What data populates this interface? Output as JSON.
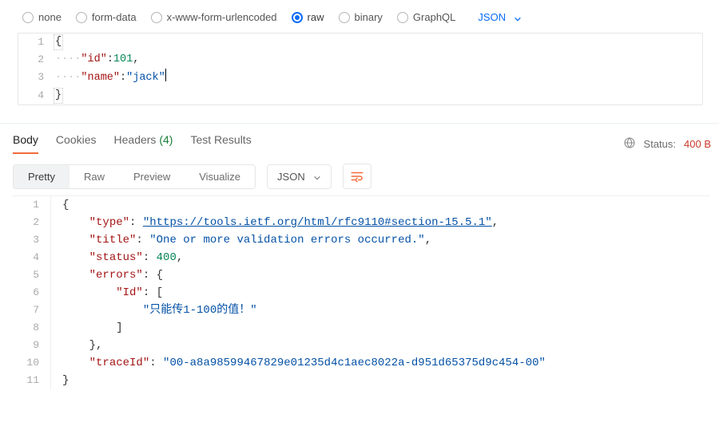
{
  "body_types": {
    "options": [
      "none",
      "form-data",
      "x-www-form-urlencoded",
      "raw",
      "binary",
      "GraphQL"
    ],
    "selected": "raw",
    "format_dropdown": "JSON"
  },
  "request_editor": {
    "lines": [
      {
        "n": 1,
        "type": "brace",
        "text": "{"
      },
      {
        "n": 2,
        "type": "kv_num",
        "indent": "····",
        "key": "\"id\"",
        "value": "101",
        "trail": ","
      },
      {
        "n": 3,
        "type": "kv_str",
        "indent": "····",
        "key": "\"name\"",
        "value": "\"jack\"",
        "cursor": true
      },
      {
        "n": 4,
        "type": "brace",
        "text": "}"
      }
    ]
  },
  "response_tabs": {
    "body": "Body",
    "cookies": "Cookies",
    "headers": "Headers",
    "headers_count": "(4)",
    "tests": "Test Results",
    "active": "Body"
  },
  "response_meta": {
    "status_label": "Status:",
    "status_value": "400 B"
  },
  "response_toolbar": {
    "pretty": "Pretty",
    "raw": "Raw",
    "preview": "Preview",
    "visualize": "Visualize",
    "format": "JSON"
  },
  "response_body": {
    "lines": [
      {
        "n": 1,
        "indent": 0,
        "tokens": [
          {
            "t": "punct",
            "v": "{"
          }
        ]
      },
      {
        "n": 2,
        "indent": 1,
        "tokens": [
          {
            "t": "key",
            "v": "\"type\""
          },
          {
            "t": "punct",
            "v": ":"
          },
          {
            "t": "sp",
            "v": " "
          },
          {
            "t": "link",
            "v": "\"https://tools.ietf.org/html/rfc9110#section-15.5.1\""
          },
          {
            "t": "punct",
            "v": ","
          }
        ]
      },
      {
        "n": 3,
        "indent": 1,
        "tokens": [
          {
            "t": "key",
            "v": "\"title\""
          },
          {
            "t": "punct",
            "v": ":"
          },
          {
            "t": "sp",
            "v": " "
          },
          {
            "t": "str",
            "v": "\"One or more validation errors occurred.\""
          },
          {
            "t": "punct",
            "v": ","
          }
        ]
      },
      {
        "n": 4,
        "indent": 1,
        "tokens": [
          {
            "t": "key",
            "v": "\"status\""
          },
          {
            "t": "punct",
            "v": ":"
          },
          {
            "t": "sp",
            "v": " "
          },
          {
            "t": "num",
            "v": "400"
          },
          {
            "t": "punct",
            "v": ","
          }
        ]
      },
      {
        "n": 5,
        "indent": 1,
        "tokens": [
          {
            "t": "key",
            "v": "\"errors\""
          },
          {
            "t": "punct",
            "v": ":"
          },
          {
            "t": "sp",
            "v": " "
          },
          {
            "t": "punct",
            "v": "{"
          }
        ]
      },
      {
        "n": 6,
        "indent": 2,
        "tokens": [
          {
            "t": "key",
            "v": "\"Id\""
          },
          {
            "t": "punct",
            "v": ":"
          },
          {
            "t": "sp",
            "v": " "
          },
          {
            "t": "punct",
            "v": "["
          }
        ]
      },
      {
        "n": 7,
        "indent": 3,
        "tokens": [
          {
            "t": "str",
            "v": "\"只能传1-100的值！\""
          }
        ]
      },
      {
        "n": 8,
        "indent": 2,
        "tokens": [
          {
            "t": "punct",
            "v": "]"
          }
        ]
      },
      {
        "n": 9,
        "indent": 1,
        "tokens": [
          {
            "t": "punct",
            "v": "},"
          }
        ]
      },
      {
        "n": 10,
        "indent": 1,
        "tokens": [
          {
            "t": "key",
            "v": "\"traceId\""
          },
          {
            "t": "punct",
            "v": ":"
          },
          {
            "t": "sp",
            "v": " "
          },
          {
            "t": "str",
            "v": "\"00-a8a98599467829e01235d4c1aec8022a-d951d65375d9c454-00\""
          }
        ]
      },
      {
        "n": 11,
        "indent": 0,
        "tokens": [
          {
            "t": "punct",
            "v": "}"
          }
        ]
      }
    ]
  }
}
